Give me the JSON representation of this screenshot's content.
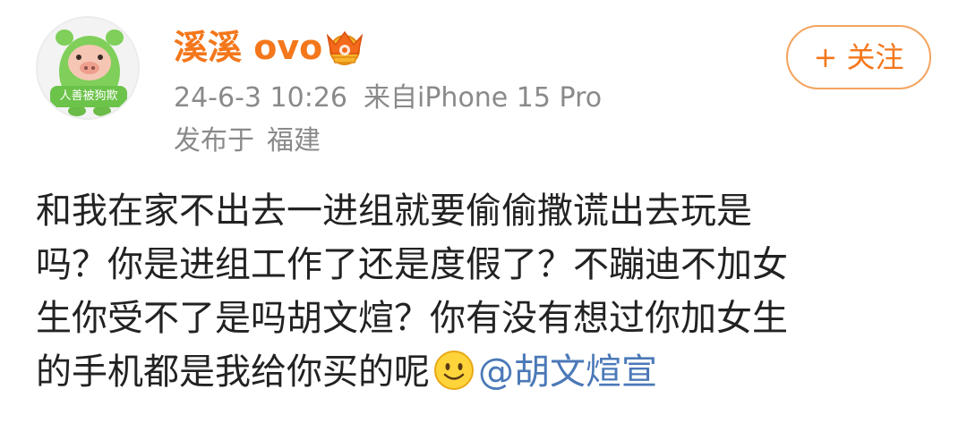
{
  "user": {
    "name": "溪溪 ovo",
    "avatar_badge": "人善被狗欺",
    "avatar_icon": "pig-avatar-icon",
    "vip_icon": "crown-icon"
  },
  "meta": {
    "timestamp": "24-6-3 10:26",
    "source": "来自iPhone 15 Pro",
    "location_prefix": "发布于",
    "location": "福建"
  },
  "follow_label": "+ 关注",
  "colors": {
    "username": "#f4771b",
    "meta": "#8a8a8a",
    "mention": "#4b79b8",
    "follow_border": "#f4a35e"
  },
  "post": {
    "lines": [
      "和我在家不出去一进组就要偷偷撒谎出去玩是",
      "吗？你是进组工作了还是度假了？不蹦迪不加女",
      "生你受不了是吗胡文煊？你有没有想过你加女生",
      "的手机都是我给你买的呢"
    ],
    "emoji": "smiley-icon",
    "mention": "@胡文煊宣"
  }
}
